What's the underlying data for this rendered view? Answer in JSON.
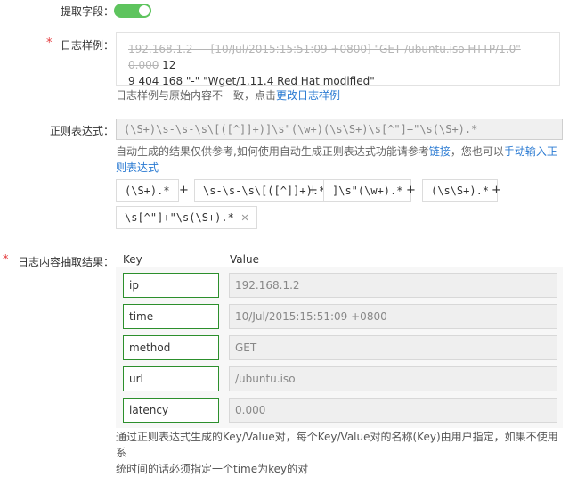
{
  "extract_field": {
    "label": "提取字段：",
    "enabled": true
  },
  "log_sample": {
    "label": "日志样例：",
    "required_mark": "*",
    "line1_struck": "192.168.1.2 - - [10/Jul/2015:15:51:09 +0800] \"GET /ubuntu.iso HTTP/1.0\" 0.000",
    "line1_tail": " 12",
    "line2": "9 404 168 \"-\" \"Wget/1.11.4 Red Hat modified\"",
    "hint_text": "日志样例与原始内容不一致，点击",
    "hint_link": "更改日志样例"
  },
  "regex": {
    "label": "正则表达式：",
    "value": "(\\S+)\\s-\\s-\\s\\[([^]]+)]\\s\"(\\w+)(\\s\\S+)\\s[^\"]+\"\\s(\\S+).*",
    "hint_part1": "自动生成的结果仅供参考,如何使用自动生成正则表达式功能请参考",
    "hint_link1": "链接",
    "hint_part2": "，您也可以",
    "hint_link2": "手动输入正",
    "hint_link2b": "则表达式",
    "chips": [
      "(\\S+).*",
      "\\s-\\s-\\s\\[([^]]+).*",
      "]\\s\"(\\w+).*",
      "(\\s\\S+).*",
      "\\s[^\"]+\"\\s(\\S+).*"
    ],
    "plus": "+",
    "close_glyph": "✕"
  },
  "results": {
    "label": "日志内容抽取结果：",
    "required_mark": "*",
    "key_header": "Key",
    "value_header": "Value",
    "rows": [
      {
        "key": "ip",
        "value": "192.168.1.2"
      },
      {
        "key": "time",
        "value": "10/Jul/2015:15:51:09 +0800"
      },
      {
        "key": "method",
        "value": "GET"
      },
      {
        "key": "url",
        "value": " /ubuntu.iso"
      },
      {
        "key": "latency",
        "value": "0.000"
      }
    ],
    "footer_line1": "通过正则表达式生成的Key/Value对，每个Key/Value对的名称(Key)由用户指定，如果不使用系",
    "footer_line2": "统时间的话必须指定一个time为key的对"
  },
  "colors": {
    "toggle_on": "#5ec45e",
    "link": "#2a7ad2",
    "required": "#e4393c",
    "key_border": "#2c8f2c"
  }
}
